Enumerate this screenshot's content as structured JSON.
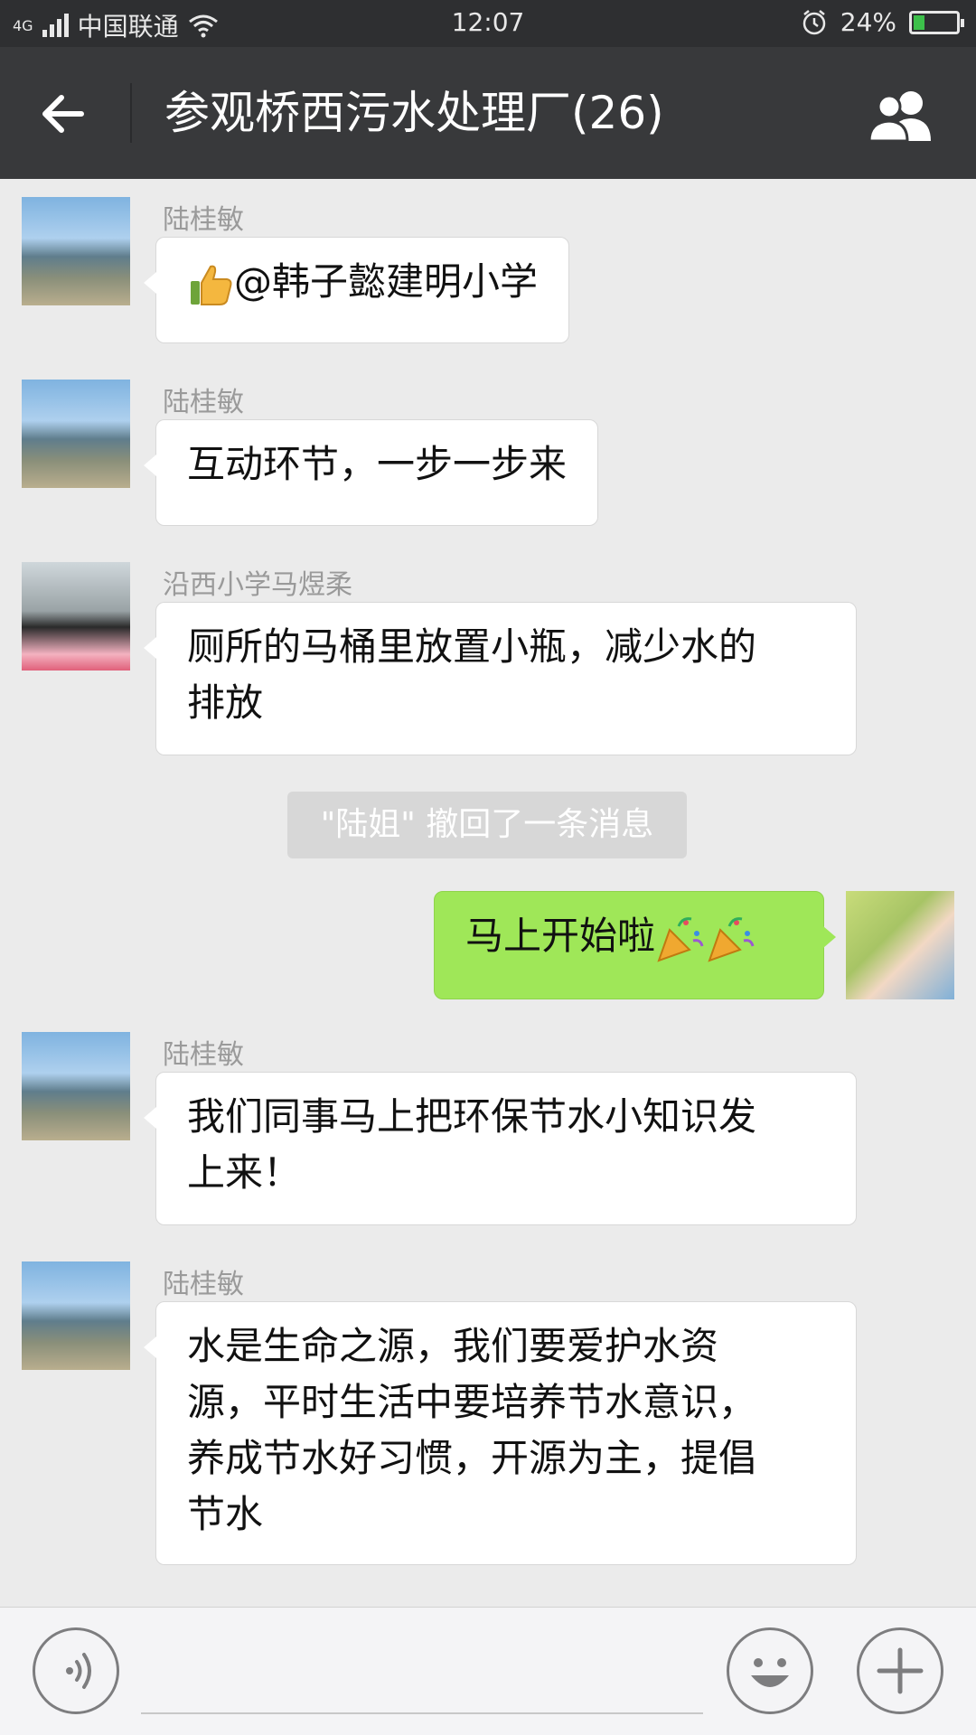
{
  "status_bar": {
    "network": "4G",
    "carrier": "中国联通",
    "time": "12:07",
    "battery": "24%",
    "battery_level": 0.24
  },
  "nav": {
    "title": "参观桥西污水处理厂(26)"
  },
  "messages": [
    {
      "sender": "陆桂敏",
      "text": "@韩子懿建明小学",
      "side": "left",
      "emoji": "thumbs-up-icon"
    },
    {
      "sender": "陆桂敏",
      "text": "互动环节，一步一步来",
      "side": "left"
    },
    {
      "sender": "沿西小学马煜柔",
      "text_lines": [
        "厕所的马桶里放置小瓶，减少水的",
        "排放"
      ],
      "side": "left"
    },
    {
      "sender": "陆桂敏",
      "text_lines": [
        "我们同事马上把环保节水小知识发",
        "上来！"
      ],
      "side": "left"
    },
    {
      "sender": "陆桂敏",
      "text_lines": [
        "水是生命之源，我们要爱护水资",
        "源，平时生活中要培养节水意识，",
        "养成节水好习惯，开源为主，提倡",
        "节水"
      ],
      "side": "left"
    }
  ],
  "system_notice": "\"陆姐\" 撤回了一条消息",
  "own_message": {
    "text": "马上开始啦",
    "emoji": "party-popper-icon"
  },
  "colors": {
    "nav_bg": "#38393b",
    "status_bg": "#2e2f31",
    "own_bubble": "#9fe758",
    "chat_bg": "#ebebeb"
  }
}
